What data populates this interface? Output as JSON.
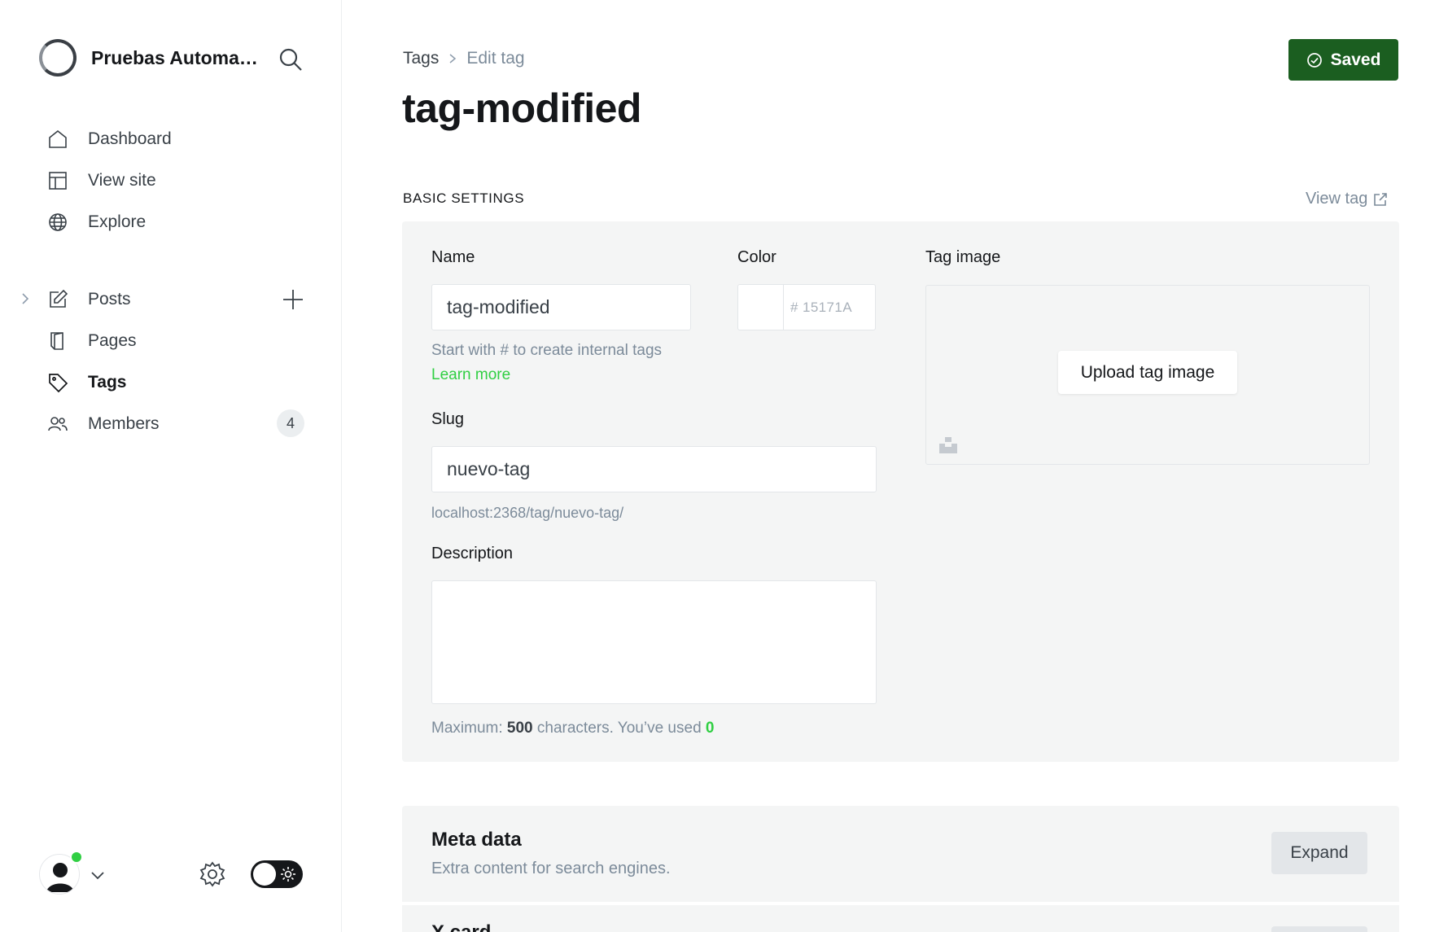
{
  "sidebar": {
    "site_title": "Pruebas Automatizadas",
    "nav": [
      {
        "label": "Dashboard",
        "icon": "home-icon"
      },
      {
        "label": "View site",
        "icon": "layout-icon"
      },
      {
        "label": "Explore",
        "icon": "globe-icon"
      }
    ],
    "content_nav": [
      {
        "label": "Posts",
        "icon": "edit-icon"
      },
      {
        "label": "Pages",
        "icon": "page-icon"
      },
      {
        "label": "Tags",
        "icon": "tag-icon",
        "active": true
      },
      {
        "label": "Members",
        "icon": "members-icon",
        "badge": "4"
      }
    ]
  },
  "header": {
    "breadcrumb_parent": "Tags",
    "breadcrumb_current": "Edit tag",
    "title": "tag-modified",
    "save_label": "Saved",
    "save_color": "#1b5e20"
  },
  "basic": {
    "section_label": "BASIC SETTINGS",
    "view_tag_label": "View tag",
    "name_label": "Name",
    "name_value": "tag-modified",
    "name_hint": "Start with # to create internal tags",
    "learn_more": "Learn more",
    "color_label": "Color",
    "color_value": "# 15171A",
    "image_label": "Tag image",
    "upload_label": "Upload tag image",
    "slug_label": "Slug",
    "slug_value": "nuevo-tag",
    "slug_url": "localhost:2368/tag/nuevo-tag/",
    "description_label": "Description",
    "description_value": "",
    "count_prefix": "Maximum:",
    "count_max": "500",
    "count_mid": "characters. You’ve used",
    "count_used": "0"
  },
  "meta": {
    "title": "Meta data",
    "subtitle": "Extra content for search engines.",
    "expand_label": "Expand"
  },
  "xcard": {
    "title": "X card"
  },
  "colors": {
    "accent_green": "#30cf43",
    "saved_green": "#1b5e20"
  }
}
